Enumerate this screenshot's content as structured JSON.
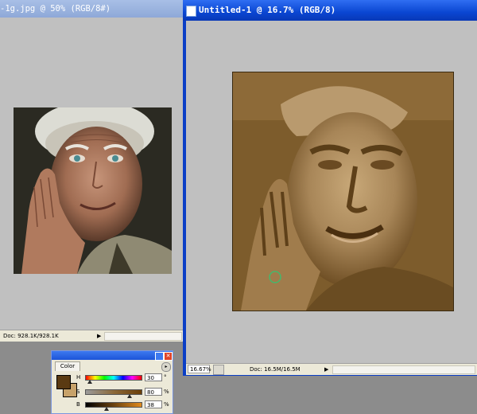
{
  "left_window": {
    "title": "-1g.jpg @ 50% (RGB/8#)",
    "status_doc": "Doc: 928.1K/928.1K",
    "status_arrow": "▶",
    "scroll_left": "◀"
  },
  "right_window": {
    "title": "Untitled-1 @ 16.7% (RGB/8)",
    "zoom": "16.67%",
    "status_doc": "Doc: 16.5M/16.5M",
    "status_arrow": "▶",
    "scroll_left": "◀"
  },
  "color_palette": {
    "tab_label": "Color",
    "menu_glyph": "▸",
    "close_glyph": "✕",
    "channels": [
      {
        "label": "H",
        "value": "30",
        "unit": "°",
        "fraction": 0.083
      },
      {
        "label": "S",
        "value": "80",
        "unit": "%",
        "fraction": 0.8
      },
      {
        "label": "B",
        "value": "38",
        "unit": "%",
        "fraction": 0.38
      }
    ],
    "foreground_color": "#5a3a12",
    "background_color": "#c7a26a"
  },
  "icons": [
    "doc-icon",
    "close-icon",
    "minimize-icon",
    "palette-menu-icon",
    "zoom-menu-icon",
    "brush-cursor-icon"
  ]
}
